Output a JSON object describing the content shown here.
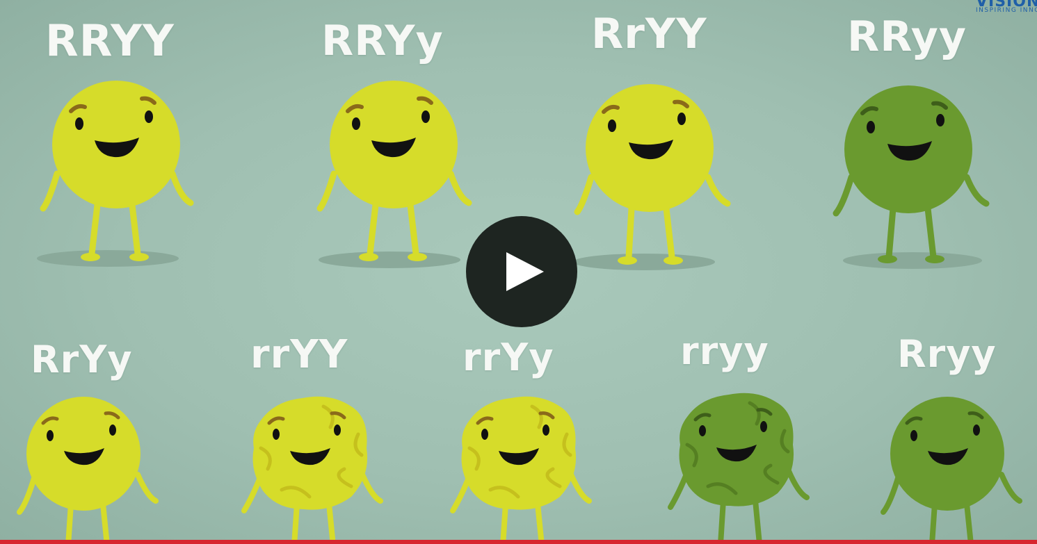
{
  "video": {
    "logo": {
      "brand": "VISION",
      "tagline": "INSPIRING INNOVATION"
    },
    "play_button_label": "Play video",
    "colors": {
      "yellow_pea": "#d6dc2a",
      "green_pea": "#6a9a2f",
      "progress_bar": "#d7262f",
      "play_button": "#1e2521"
    },
    "genotypes_row1": [
      "RRYY",
      "RRYy",
      "RrYY",
      "RRyy"
    ],
    "genotypes_row2": [
      "RrYy",
      "rrYY",
      "rrYy",
      "rryy",
      "Rryy"
    ]
  }
}
